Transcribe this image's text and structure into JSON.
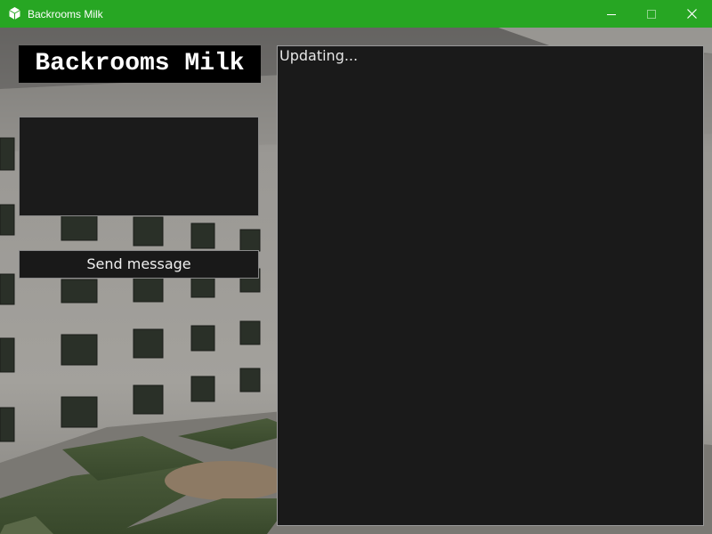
{
  "window": {
    "title": "Backrooms Milk",
    "icon": "app-icon",
    "controls": [
      "minimize-icon",
      "maximize-icon",
      "close-icon"
    ],
    "accent_color": "#27a623"
  },
  "main": {
    "app_name": "Backrooms Milk",
    "message_input": {
      "value": "",
      "placeholder": ""
    },
    "send_button_label": "Send message",
    "output_text": "Updating..."
  }
}
